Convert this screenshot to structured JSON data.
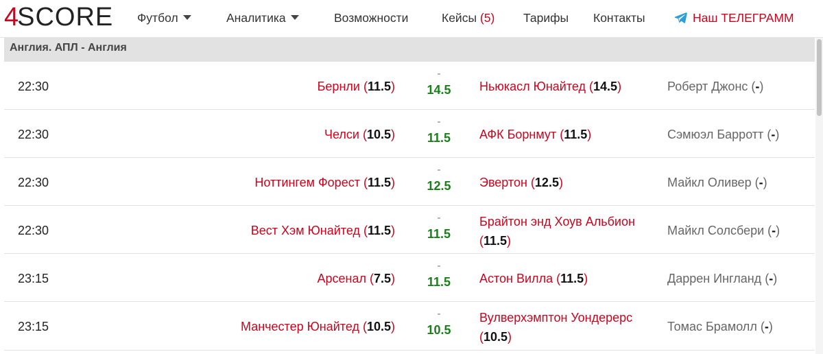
{
  "nav": {
    "logo_prefix": "4",
    "logo_rest": "SCORE",
    "football": "Футбол",
    "analytics": "Аналитика",
    "features": "Возможности",
    "cases": "Кейсы",
    "cases_count": "(5)",
    "tariffs": "Тарифы",
    "contacts": "Контакты",
    "telegram": "Наш ТЕЛЕГРАММ",
    "telegram_icon": "telegram-icon",
    "accent_color": "#d0021b"
  },
  "league": {
    "title": "Англия. АПЛ - Англия"
  },
  "matches": [
    {
      "time": "22:30",
      "home": "Бернли",
      "home_val": "11.5",
      "total": "14.5",
      "away": "Ньюкасл Юнайтед",
      "away_val": "14.5",
      "referee": "Роберт Джонс",
      "ref_val": "-"
    },
    {
      "time": "22:30",
      "home": "Челси",
      "home_val": "10.5",
      "total": "11.5",
      "away": "АФК Борнмут",
      "away_val": "11.5",
      "referee": "Сэмюэл Барротт",
      "ref_val": "-"
    },
    {
      "time": "22:30",
      "home": "Ноттингем Форест",
      "home_val": "11.5",
      "total": "12.5",
      "away": "Эвертон",
      "away_val": "12.5",
      "referee": "Майкл Оливер",
      "ref_val": "-"
    },
    {
      "time": "22:30",
      "home": "Вест Хэм Юнайтед",
      "home_val": "11.5",
      "total": "11.5",
      "away": "Брайтон энд Хоув Альбион",
      "away_val": "11.5",
      "referee": "Майкл Солсбери",
      "ref_val": "-"
    },
    {
      "time": "23:15",
      "home": "Арсенал",
      "home_val": "7.5",
      "total": "11.5",
      "away": "Астон Вилла",
      "away_val": "11.5",
      "referee": "Даррен Ингланд",
      "ref_val": "-"
    },
    {
      "time": "23:15",
      "home": "Манчестер Юнайтед",
      "home_val": "10.5",
      "total": "10.5",
      "away": "Вулверхэмптон Уондерерс",
      "away_val": "10.5",
      "referee": "Томас Брамолл",
      "ref_val": "-"
    }
  ],
  "center_dash": "-",
  "total_color": "#1a7f1a"
}
